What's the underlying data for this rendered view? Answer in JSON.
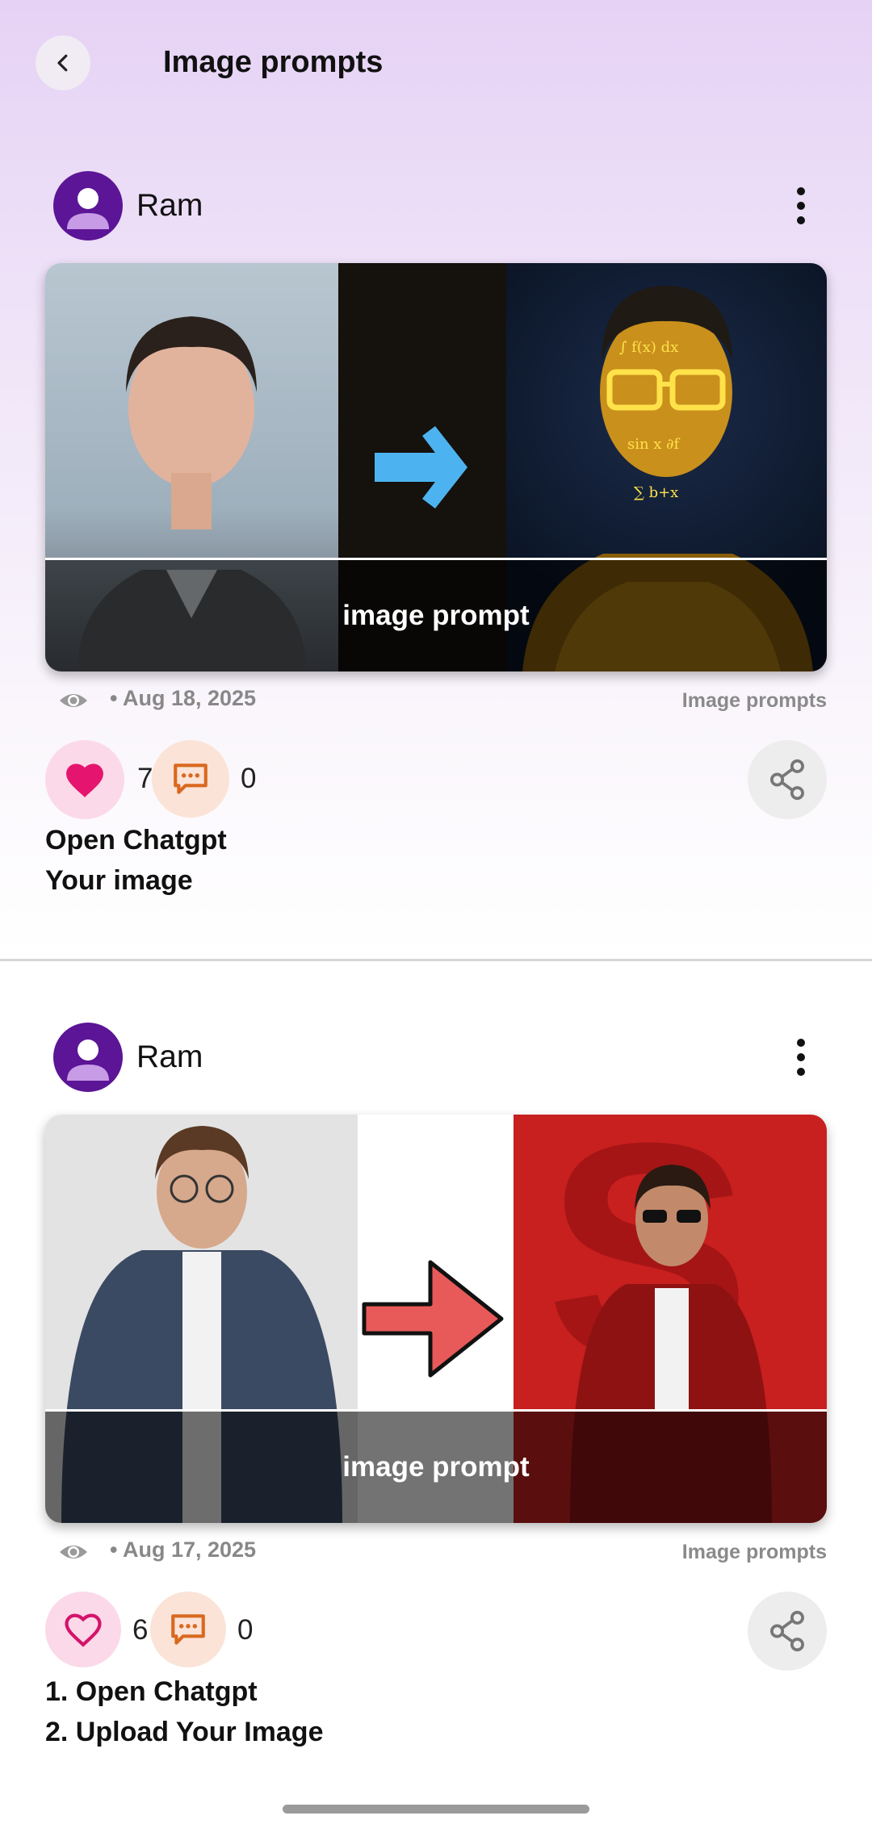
{
  "header": {
    "title": "Image prompts"
  },
  "posts": [
    {
      "author": "Ram",
      "image_caption": "image prompt",
      "date": "• Aug 18, 2025",
      "category": "Image prompts",
      "likes": "7",
      "liked": true,
      "comments": "0",
      "description": [
        "Open Chatgpt",
        "Your image"
      ],
      "arrow_color": "#4db3f0"
    },
    {
      "author": "Ram",
      "image_caption": "image prompt",
      "date": "• Aug 17, 2025",
      "category": "Image prompts",
      "likes": "6",
      "liked": false,
      "comments": "0",
      "description": [
        "1. Open Chatgpt",
        "2. Upload Your Image"
      ],
      "arrow_color": "#e85a5a"
    }
  ],
  "colors": {
    "accent": "#5b1596",
    "like": "#e5156f",
    "comment": "#d9691f"
  }
}
